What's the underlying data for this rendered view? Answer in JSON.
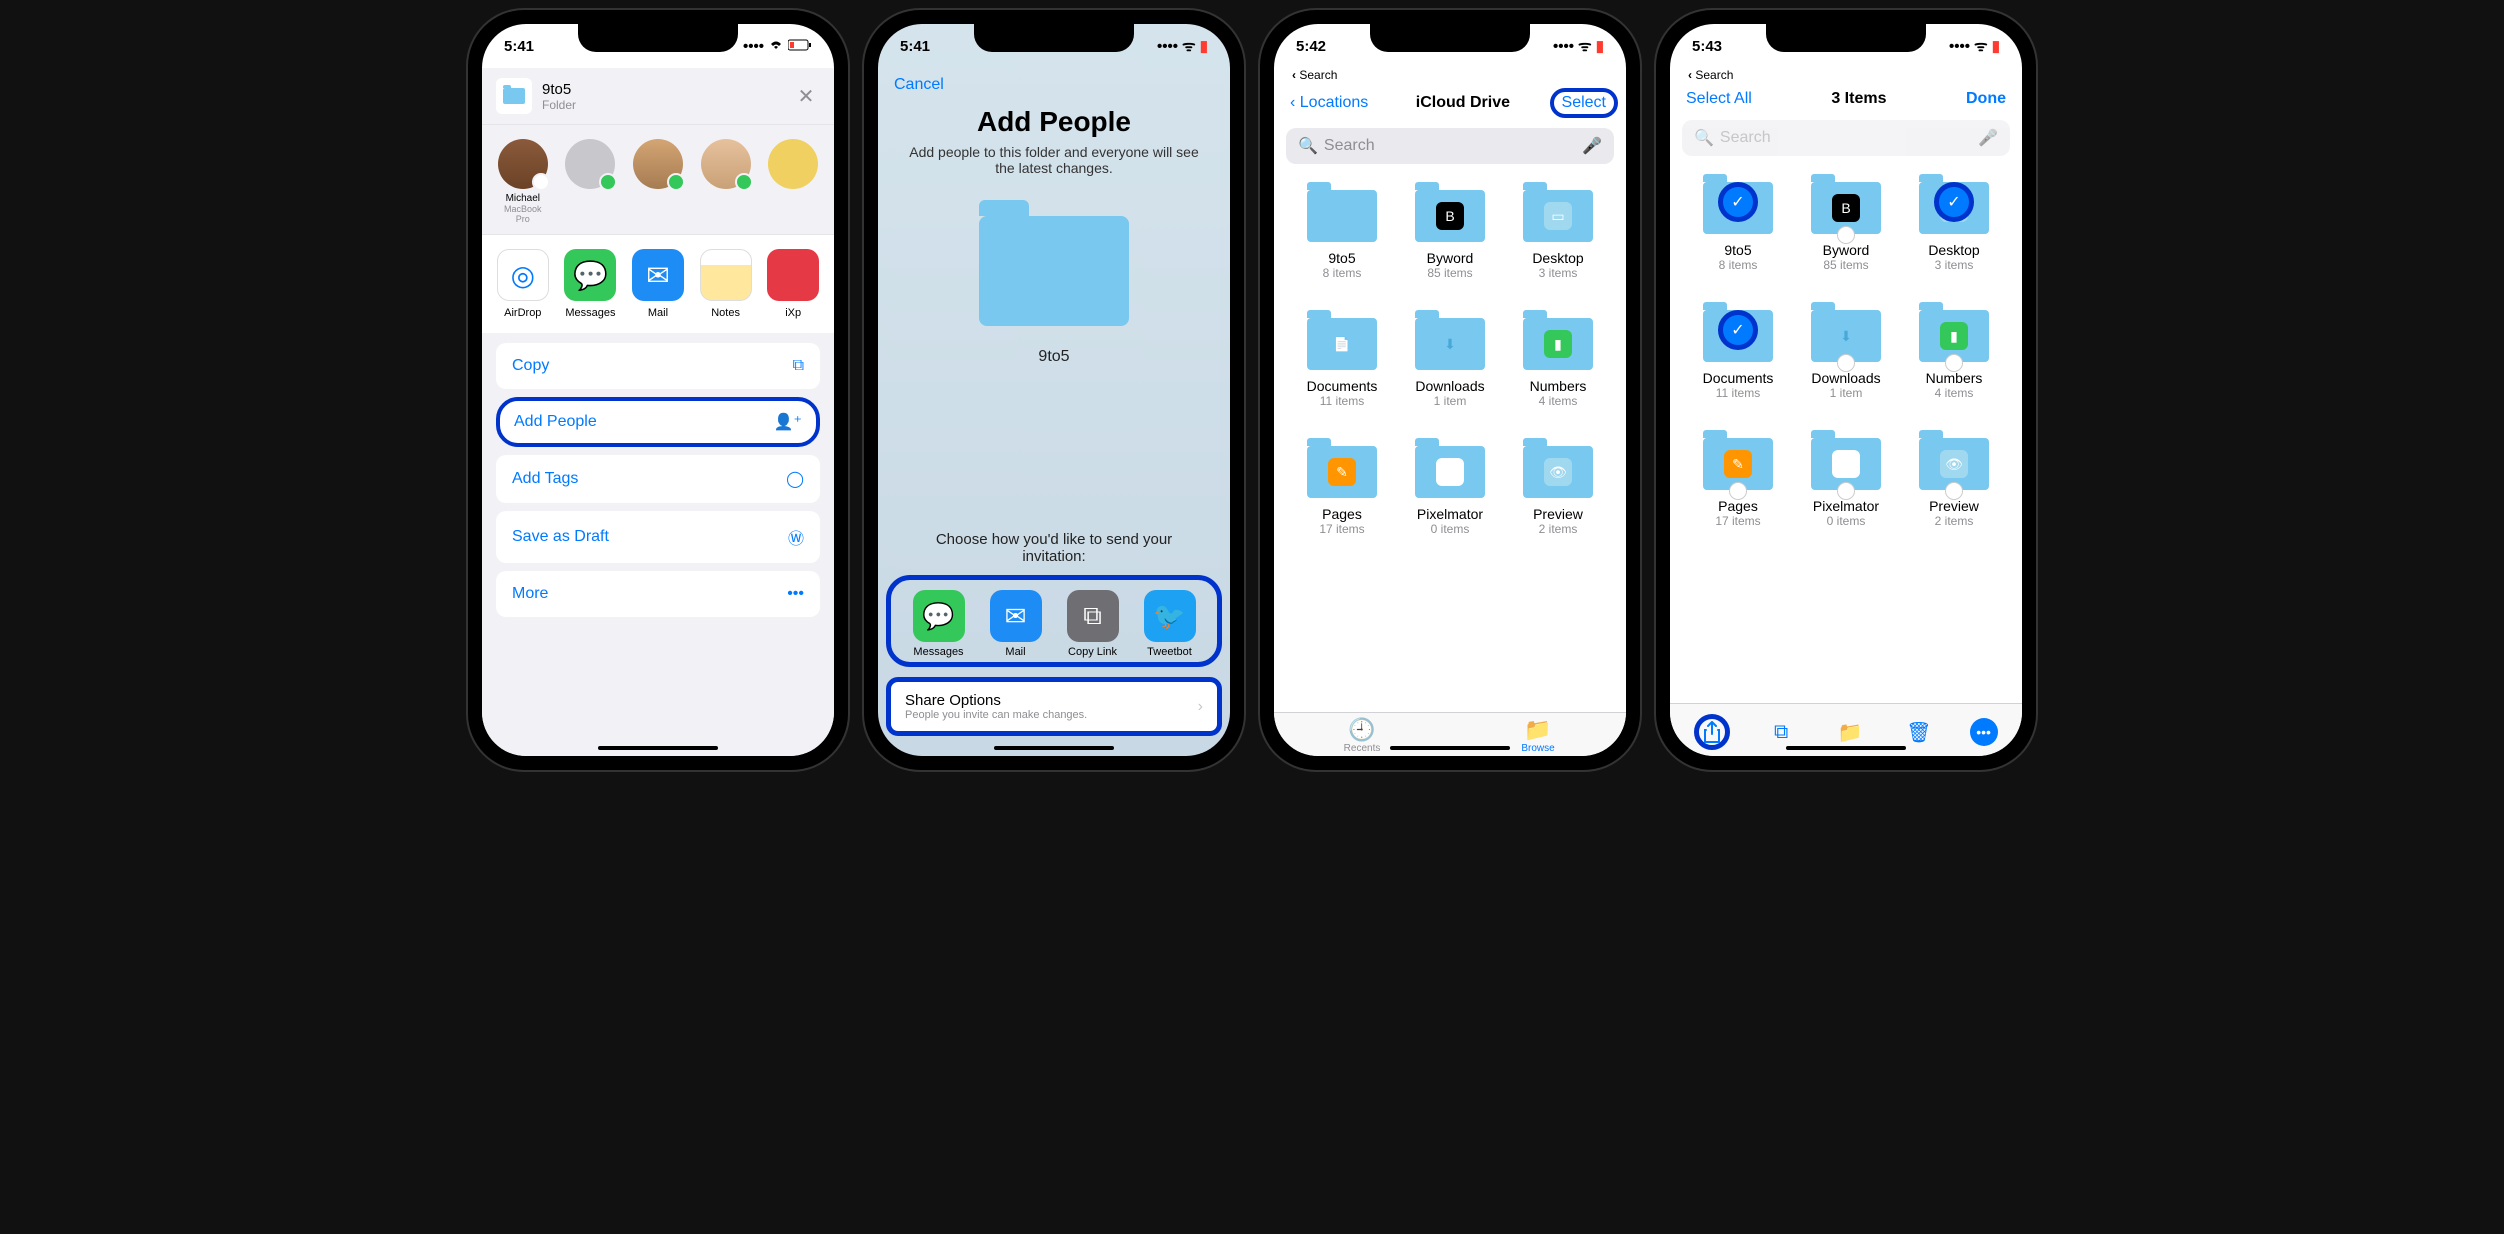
{
  "status": {
    "t1": "5:41",
    "t2": "5:41",
    "t3": "5:42",
    "t4": "5:43"
  },
  "back_search": "Search",
  "p1": {
    "title": "9to5",
    "subtitle": "Folder",
    "contacts": [
      {
        "name": "Michael",
        "sub": "MacBook Pro"
      },
      {
        "name": ""
      },
      {
        "name": ""
      },
      {
        "name": ""
      }
    ],
    "apps": [
      {
        "name": "AirDrop"
      },
      {
        "name": "Messages"
      },
      {
        "name": "Mail"
      },
      {
        "name": "Notes"
      },
      {
        "name": "iXp"
      }
    ],
    "actions": {
      "copy": "Copy",
      "add_people": "Add People",
      "add_tags": "Add Tags",
      "save_draft": "Save as Draft",
      "more": "More"
    }
  },
  "p2": {
    "cancel": "Cancel",
    "title": "Add People",
    "sub": "Add people to this folder and everyone will see the latest changes.",
    "folder_name": "9to5",
    "invite_label": "Choose how you'd like to send your invitation:",
    "apps": {
      "messages": "Messages",
      "mail": "Mail",
      "copy": "Copy Link",
      "tweet": "Tweetbot"
    },
    "share_options": "Share Options",
    "share_options_sub": "People you invite can make changes."
  },
  "p3": {
    "back": "Locations",
    "title": "iCloud Drive",
    "select": "Select",
    "search_placeholder": "Search",
    "items": [
      {
        "name": "9to5",
        "count": "8 items"
      },
      {
        "name": "Byword",
        "count": "85 items"
      },
      {
        "name": "Desktop",
        "count": "3 items"
      },
      {
        "name": "Documents",
        "count": "11 items"
      },
      {
        "name": "Downloads",
        "count": "1 item"
      },
      {
        "name": "Numbers",
        "count": "4 items"
      },
      {
        "name": "Pages",
        "count": "17 items"
      },
      {
        "name": "Pixelmator",
        "count": "0 items"
      },
      {
        "name": "Preview",
        "count": "2 items"
      }
    ],
    "tabs": {
      "recents": "Recents",
      "browse": "Browse"
    }
  },
  "p4": {
    "select_all": "Select All",
    "title": "3 Items",
    "done": "Done",
    "search_placeholder": "Search",
    "items": [
      {
        "name": "9to5",
        "count": "8 items",
        "sel": true
      },
      {
        "name": "Byword",
        "count": "85 items",
        "sel": false
      },
      {
        "name": "Desktop",
        "count": "3 items",
        "sel": true
      },
      {
        "name": "Documents",
        "count": "11 items",
        "sel": true
      },
      {
        "name": "Downloads",
        "count": "1 item",
        "sel": false
      },
      {
        "name": "Numbers",
        "count": "4 items",
        "sel": false
      },
      {
        "name": "Pages",
        "count": "17 items",
        "sel": false
      },
      {
        "name": "Pixelmator",
        "count": "0 items",
        "sel": false
      },
      {
        "name": "Preview",
        "count": "2 items",
        "sel": false
      }
    ]
  }
}
